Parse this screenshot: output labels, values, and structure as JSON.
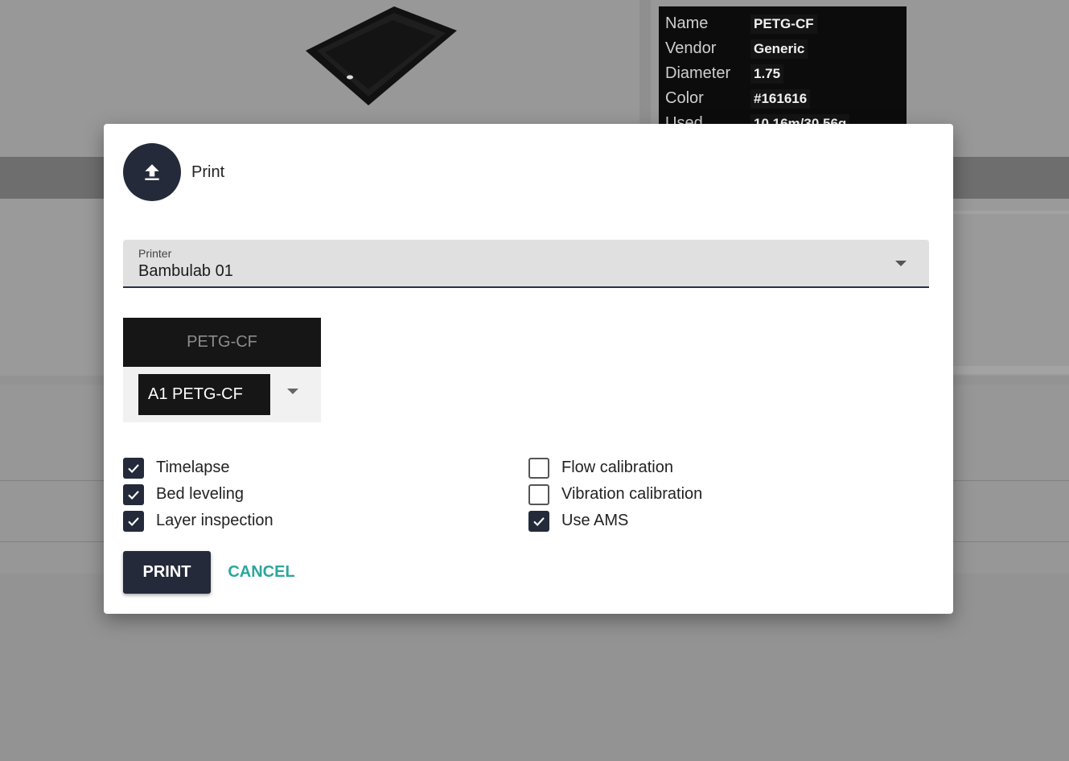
{
  "background": {
    "filament_info": [
      {
        "key": "Name",
        "value": "PETG-CF"
      },
      {
        "key": "Vendor",
        "value": "Generic"
      },
      {
        "key": "Diameter",
        "value": "1.75"
      },
      {
        "key": "Color",
        "value": "#161616"
      },
      {
        "key": "Used",
        "value": "10.16m/30.56g"
      }
    ]
  },
  "dialog": {
    "icon": "upload-icon",
    "title": "Print",
    "printer_select": {
      "label": "Printer",
      "value": "Bambulab 01"
    },
    "filament": {
      "name": "PETG-CF",
      "color": "#161616",
      "slot_value": "A1 PETG-CF"
    },
    "options_left": [
      {
        "label": "Timelapse",
        "checked": true
      },
      {
        "label": "Bed leveling",
        "checked": true
      },
      {
        "label": "Layer inspection",
        "checked": true
      }
    ],
    "options_right": [
      {
        "label": "Flow calibration",
        "checked": false
      },
      {
        "label": "Vibration calibration",
        "checked": false
      },
      {
        "label": "Use AMS",
        "checked": true
      }
    ],
    "actions": {
      "print_label": "PRINT",
      "cancel_label": "CANCEL"
    }
  },
  "colors": {
    "primary": "#242a3a",
    "accent": "#2ca69a",
    "overlay": "#939393"
  }
}
